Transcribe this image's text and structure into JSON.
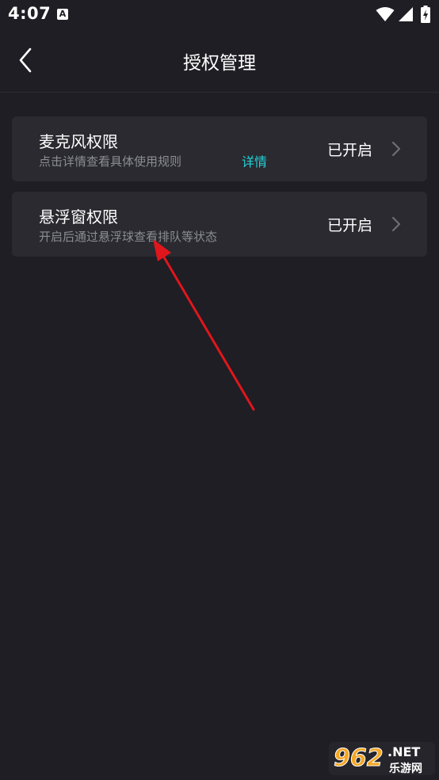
{
  "status_bar": {
    "time": "4:07",
    "notification_glyph": "A"
  },
  "header": {
    "title": "授权管理",
    "back_icon": "chevron-left-icon"
  },
  "permissions": [
    {
      "title": "麦克风权限",
      "description": "点击详情查看具体使用规则",
      "link": "详情",
      "status": "已开启"
    },
    {
      "title": "悬浮窗权限",
      "description": "开启后通过悬浮球查看排队等状态",
      "status": "已开启"
    }
  ],
  "watermark": {
    "number": "962",
    "suffix": ".NET",
    "chinese": "乐游网"
  },
  "colors": {
    "background": "#1e1e24",
    "card": "#2a2a30",
    "accent": "#22d3d9",
    "annotation": "#e0161c"
  }
}
